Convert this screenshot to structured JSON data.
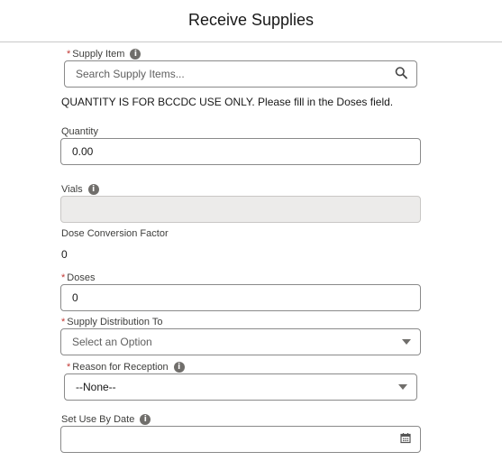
{
  "header": {
    "title": "Receive Supplies"
  },
  "form": {
    "supply_item": {
      "required_mark": "*",
      "label": "Supply Item",
      "placeholder": "Search Supply Items...",
      "icon": "search-icon"
    },
    "notice": "QUANTITY IS FOR BCCDC USE ONLY. Please fill in the Doses field.",
    "quantity": {
      "label": "Quantity",
      "value": "0.00"
    },
    "vials": {
      "label": "Vials",
      "value": ""
    },
    "dose_conversion": {
      "label": "Dose Conversion Factor",
      "value": "0"
    },
    "doses": {
      "required_mark": "*",
      "label": "Doses",
      "value": "0"
    },
    "supply_distribution": {
      "required_mark": "*",
      "label": "Supply Distribution To",
      "value": "Select an Option"
    },
    "reason": {
      "required_mark": "*",
      "label": "Reason for Reception",
      "value": "--None--"
    },
    "use_by_date": {
      "label": "Set Use By Date",
      "value": "",
      "icon": "calendar-icon"
    }
  },
  "info_icon_glyph": "i"
}
